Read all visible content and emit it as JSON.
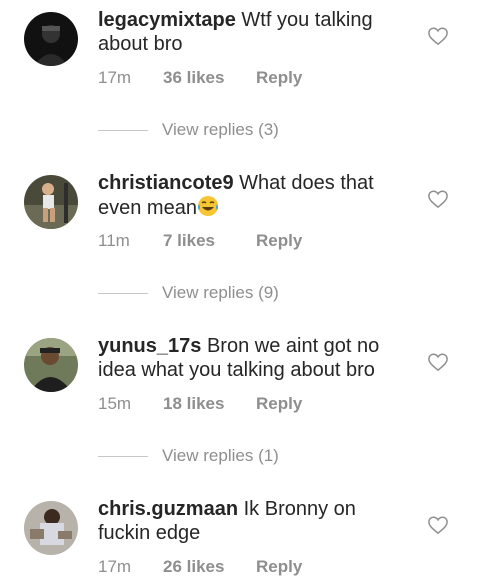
{
  "comments": [
    {
      "username": "legacymixtape",
      "text": "Wtf you talking about bro",
      "time": "17m",
      "likes": "36 likes",
      "reply": "Reply",
      "view_replies": "View replies (3)"
    },
    {
      "username": "christiancote9",
      "text": "What does that even mean",
      "emoji": "face-with-tears-of-joy",
      "time": "11m",
      "likes": "7 likes",
      "reply": "Reply",
      "view_replies": "View replies (9)"
    },
    {
      "username": "yunus_17s",
      "text": "Bron we aint got no idea what you talking about bro",
      "time": "15m",
      "likes": "18 likes",
      "reply": "Reply",
      "view_replies": "View replies (1)"
    },
    {
      "username": "chris.guzmaan",
      "text": "Ik Bronny on fuckin edge",
      "time": "17m",
      "likes": "26 likes",
      "reply": "Reply"
    }
  ],
  "colors": {
    "text": "#262626",
    "muted": "#8e8e8e",
    "divider": "#c7c7c7"
  }
}
